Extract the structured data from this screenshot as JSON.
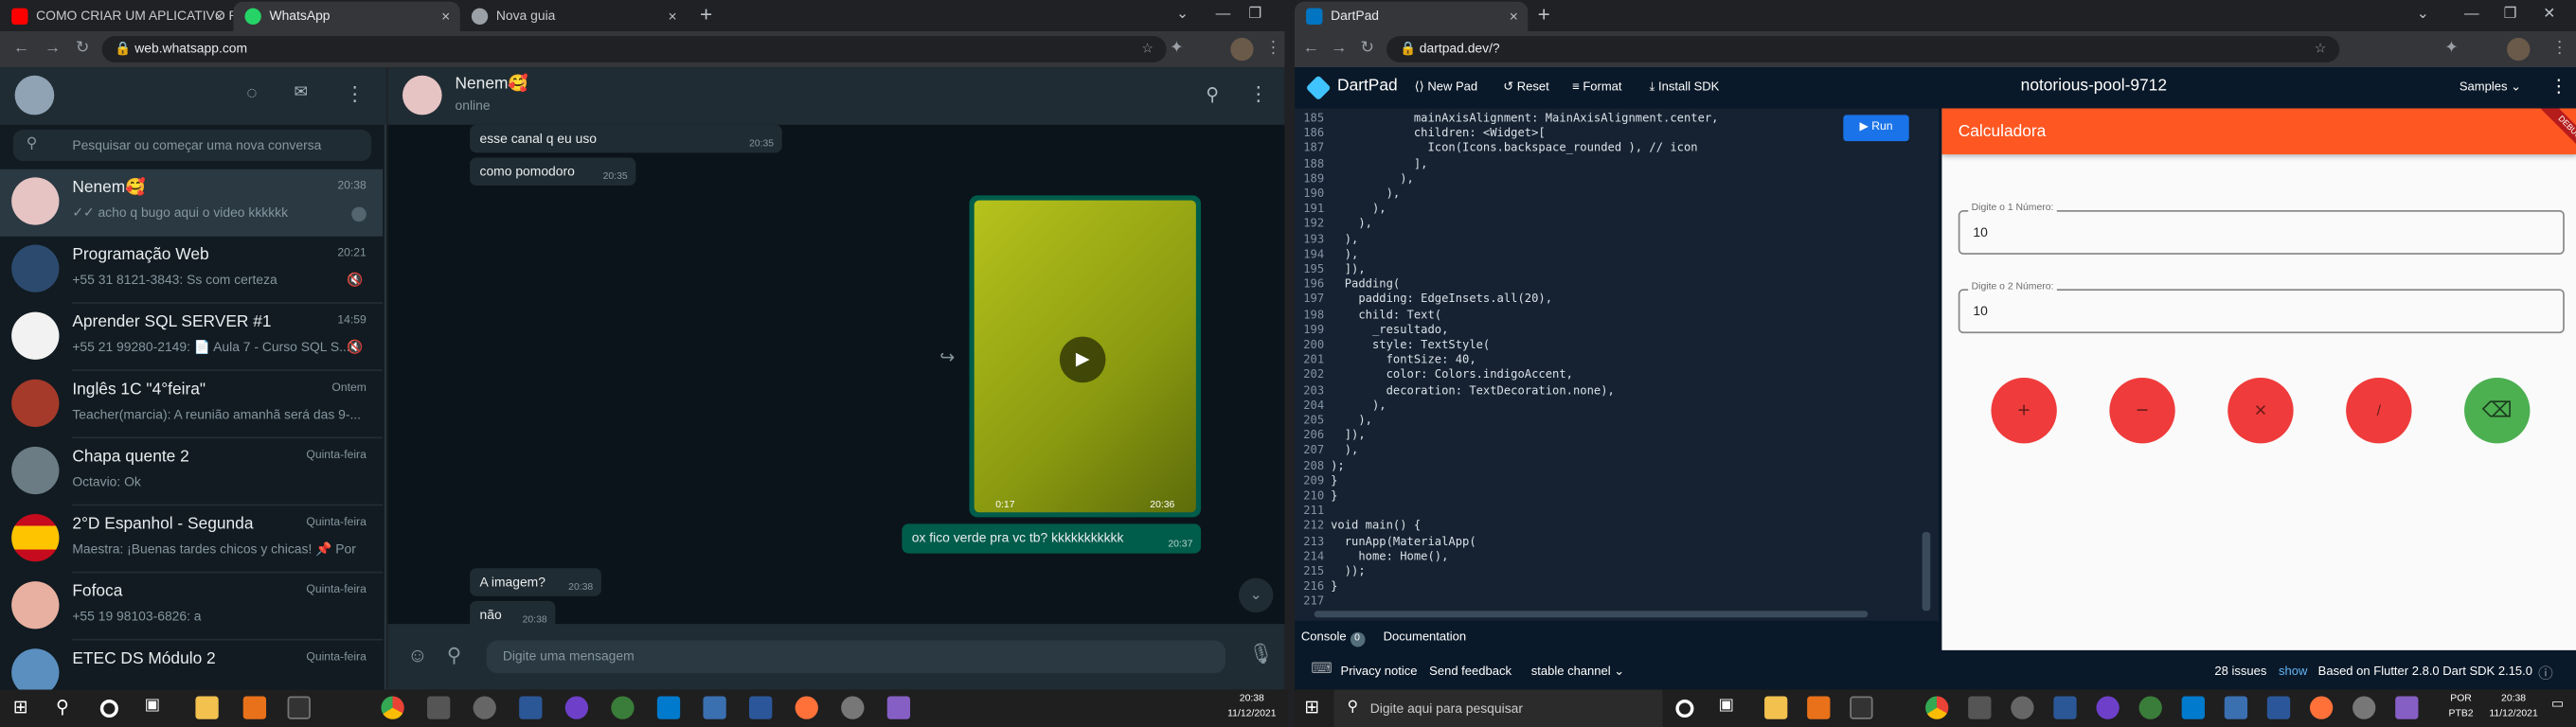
{
  "left_browser": {
    "tabs": [
      {
        "label": "COMO CRIAR UM APLICATIVO P...",
        "close": "×"
      },
      {
        "label": "WhatsApp",
        "close": "×"
      },
      {
        "label": "Nova guia",
        "close": "×"
      }
    ],
    "new_tab": "+",
    "url": "web.whatsapp.com"
  },
  "whatsapp": {
    "search_placeholder": "Pesquisar ou começar uma nova conversa",
    "chats": [
      {
        "name": "Nenem🥰",
        "preview": "✓✓ acho q bugo aqui o video kkkkkk",
        "time": "20:38"
      },
      {
        "name": "Programação Web",
        "preview": "+55 31 8121-3843: Ss com certeza",
        "time": "20:21"
      },
      {
        "name": "Aprender SQL SERVER #1",
        "preview": "+55 21 99280-2149: 📄 Aula 7 - Curso SQL S...",
        "time": "14:59"
      },
      {
        "name": "Inglês 1C \"4°feira\"",
        "preview": "Teacher(marcia): A reunião amanhã será das 9-...",
        "time": "Ontem"
      },
      {
        "name": "Chapa quente 2",
        "preview": "Octavio: Ok",
        "time": "Quinta-feira"
      },
      {
        "name": "2°D Espanhol - Segunda",
        "preview": "Maestra: ¡Buenas tardes chicos y chicas! 📌 Por ...",
        "time": "Quinta-feira"
      },
      {
        "name": "Fofoca",
        "preview": "+55 19 98103-6826: a",
        "time": "Quinta-feira"
      },
      {
        "name": "ETEC DS Módulo 2",
        "preview": "",
        "time": "Quinta-feira"
      }
    ],
    "contact": {
      "name": "Nenem🥰",
      "status": "online"
    },
    "messages": [
      {
        "text": "esse canal q eu uso",
        "time": "20:35",
        "dir": "in"
      },
      {
        "text": "como pomodoro",
        "time": "20:35",
        "dir": "in"
      },
      {
        "text": "ox fico verde pra vc tb? kkkkkkkkkkk",
        "time": "20:37",
        "dir": "out"
      },
      {
        "text": "A imagem?",
        "time": "20:38",
        "dir": "in"
      },
      {
        "text": "não",
        "time": "20:38",
        "dir": "in"
      }
    ],
    "video": {
      "duration": "0:17",
      "time": "20:36"
    },
    "input_placeholder": "Digite uma mensagem"
  },
  "right_browser": {
    "tabs": [
      {
        "label": "DartPad",
        "close": "×"
      }
    ],
    "url": "dartpad.dev/?"
  },
  "dartpad": {
    "logo": "DartPad",
    "new_pad": "New Pad",
    "reset": "Reset",
    "format": "Format",
    "install_sdk": "Install SDK",
    "pad_name": "notorious-pool-9712",
    "samples": "Samples",
    "run": "Run",
    "console": "Console",
    "console_count": "0",
    "documentation": "Documentation",
    "privacy": "Privacy notice",
    "feedback": "Send feedback",
    "channel": "stable channel",
    "issues_count": "28 issues",
    "issues_show": "show",
    "sdk_info": "Based on Flutter 2.8.0 Dart SDK 2.15.0",
    "code_lines": [
      {
        "n": "185",
        "t": "            mainAxisAlignment: MainAxisAlignment.center,"
      },
      {
        "n": "186",
        "t": "            children: <Widget>["
      },
      {
        "n": "187",
        "t": "              Icon(Icons.backspace_rounded ), // icon"
      },
      {
        "n": "188",
        "t": "            ],"
      },
      {
        "n": "189",
        "t": "          ),"
      },
      {
        "n": "190",
        "t": "        ),"
      },
      {
        "n": "191",
        "t": "      ),"
      },
      {
        "n": "192",
        "t": "    ),"
      },
      {
        "n": "193",
        "t": "  ),"
      },
      {
        "n": "194",
        "t": "  ),"
      },
      {
        "n": "195",
        "t": "  ]),"
      },
      {
        "n": "196",
        "t": "  Padding("
      },
      {
        "n": "197",
        "t": "    padding: EdgeInsets.all(20),"
      },
      {
        "n": "198",
        "t": "    child: Text("
      },
      {
        "n": "199",
        "t": "      _resultado,"
      },
      {
        "n": "200",
        "t": "      style: TextStyle("
      },
      {
        "n": "201",
        "t": "        fontSize: 40,"
      },
      {
        "n": "202",
        "t": "        color: Colors.indigoAccent,"
      },
      {
        "n": "203",
        "t": "        decoration: TextDecoration.none),"
      },
      {
        "n": "204",
        "t": "      ),"
      },
      {
        "n": "205",
        "t": "    ),"
      },
      {
        "n": "206",
        "t": "  ]),"
      },
      {
        "n": "207",
        "t": "  ),"
      },
      {
        "n": "208",
        "t": ");"
      },
      {
        "n": "209",
        "t": "}"
      },
      {
        "n": "210",
        "t": "}"
      },
      {
        "n": "211",
        "t": ""
      },
      {
        "n": "212",
        "t": "void main() {"
      },
      {
        "n": "213",
        "t": "  runApp(MaterialApp("
      },
      {
        "n": "214",
        "t": "    home: Home(),"
      },
      {
        "n": "215",
        "t": "  ));"
      },
      {
        "n": "216",
        "t": "}"
      },
      {
        "n": "217",
        "t": ""
      }
    ],
    "app": {
      "title": "Calculadora",
      "debug": "DEBUG",
      "field1_label": "Digite o 1 Número:",
      "field1_value": "10",
      "field2_label": "Digite o 2 Número:",
      "field2_value": "10",
      "buttons": [
        "+",
        "−",
        "×",
        "/",
        "⌫"
      ]
    }
  },
  "taskbar": {
    "search_placeholder": "Digite aqui para pesquisar",
    "left_time": "20:38",
    "left_date": "11/12/2021",
    "lang": "POR",
    "lang2": "PTB2",
    "right_time": "20:38",
    "right_date": "11/12/2021"
  },
  "colors": {
    "wa_green": "#005c4b",
    "appbar": "#ff5722",
    "calc_red": "#ef3b3b",
    "calc_green": "#4caf50",
    "run_blue": "#1a73e8"
  }
}
